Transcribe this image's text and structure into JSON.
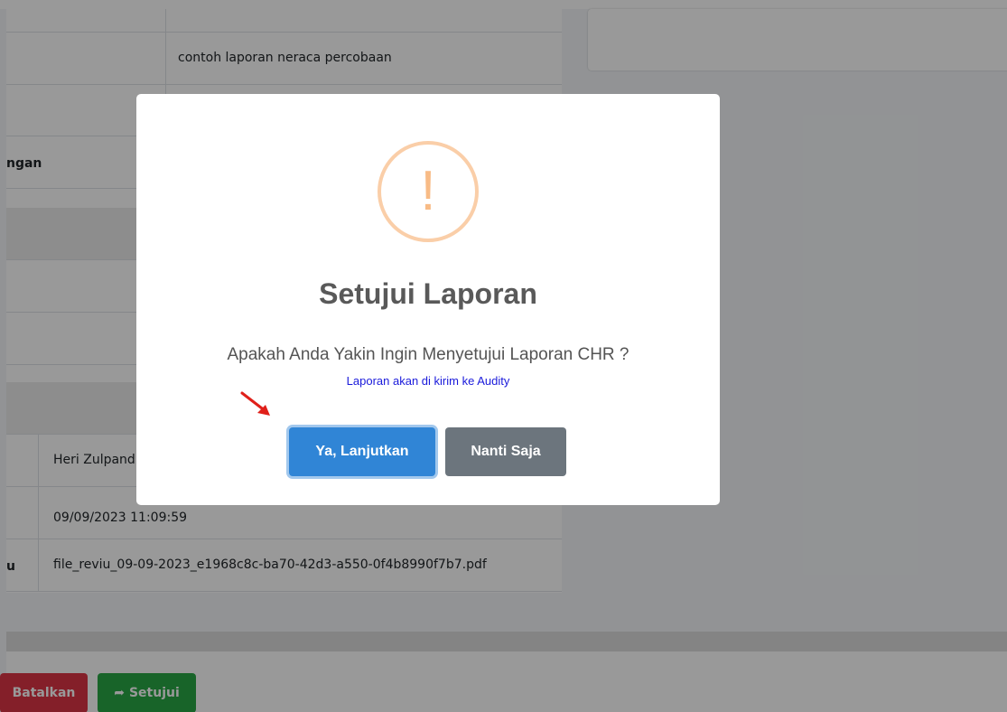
{
  "background": {
    "table_rows": [
      {
        "left": "",
        "right": "contoh laporan neraca percobaan"
      },
      {
        "left": "",
        "right": ""
      },
      {
        "left": "ngan",
        "right": ""
      },
      {
        "left": "",
        "right": "Heri Zulpand"
      },
      {
        "left": "",
        "right": "09/09/2023 11:09:59"
      },
      {
        "left": "u",
        "right": "file_reviu_09-09-2023_e1968c8c-ba70-42d3-a550-0f4b8990f7b7.pdf"
      }
    ],
    "buttons": {
      "cancel_label": "Batalkan",
      "approve_label": "Setujui"
    }
  },
  "dialog": {
    "icon": "warning-exclamation-icon",
    "icon_glyph": "!",
    "title": "Setujui Laporan",
    "message": "Apakah Anda Yakin Ingin Menyetujui Laporan CHR ?",
    "note": "Laporan akan di kirim ke Audity",
    "confirm_label": "Ya, Lanjutkan",
    "cancel_label": "Nanti Saja"
  },
  "colors": {
    "confirm": "#3085d6",
    "cancel": "#6c757d",
    "warning_ring": "#facea8",
    "warning_glyph": "#f8bb86",
    "note_text": "#1a1adb",
    "annotation_arrow": "#e0201a"
  }
}
